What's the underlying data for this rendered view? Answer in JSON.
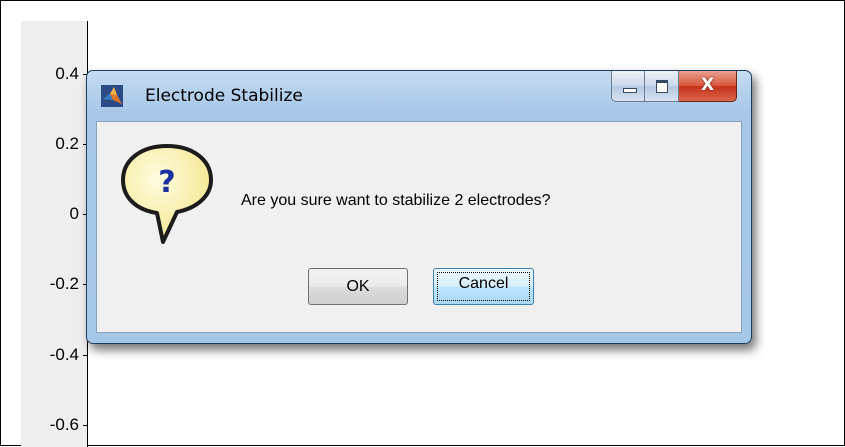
{
  "axis": {
    "tick_labels": [
      "0.4",
      "0.2",
      "0",
      "-0.2",
      "-0.4",
      "-0.6"
    ]
  },
  "dialog": {
    "title": "Electrode Stabilize",
    "message": "Are you sure want to stabilize 2 electrodes?",
    "ok_label": "OK",
    "cancel_label": "Cancel",
    "close_glyph": "X",
    "icons": {
      "app": "matlab-icon",
      "question": "question-icon",
      "minimize": "minimize-icon",
      "maximize": "maximize-icon",
      "close": "close-icon"
    }
  },
  "colors": {
    "dialog_frame": "#a9c8e8",
    "close_button": "#c6321b",
    "question_bubble": "#fbf3b0",
    "question_mark": "#1a2fa0",
    "default_button": "#3c7fb1"
  }
}
